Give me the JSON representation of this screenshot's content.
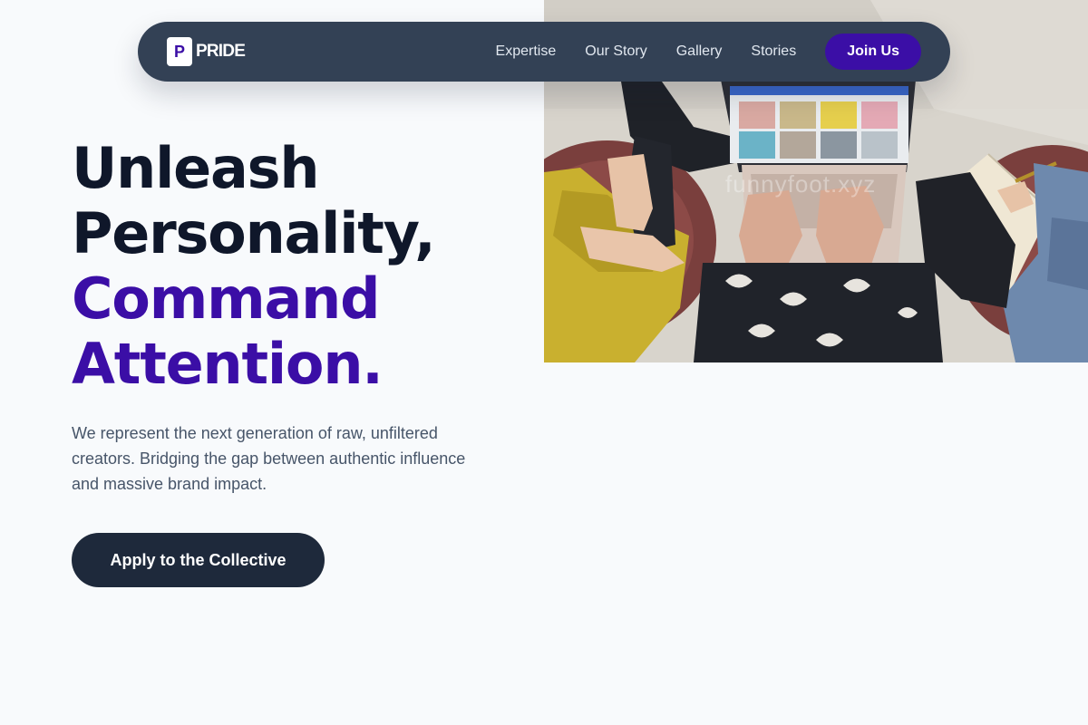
{
  "brand": {
    "mark": "P",
    "name": "PRIDE"
  },
  "nav": {
    "links": [
      "Expertise",
      "Our Story",
      "Gallery",
      "Stories"
    ],
    "cta_label": "Join Us"
  },
  "hero": {
    "headline_line1": "Unleash",
    "headline_line2": "Personality,",
    "headline_line3": "Command",
    "headline_line4": "Attention.",
    "subtext": "We represent the next generation of raw, unfiltered creators. Bridging the gap between authentic influence and massive brand impact.",
    "cta_label": "Apply to the Collective",
    "image_watermark": "funnyfoot.xyz"
  },
  "colors": {
    "accent": "#3b0ea6",
    "nav_bg": "#334155",
    "cta_bg": "#1e293b",
    "heading": "#0f172a",
    "body_text": "#475569",
    "page_bg": "#f8fafc"
  }
}
